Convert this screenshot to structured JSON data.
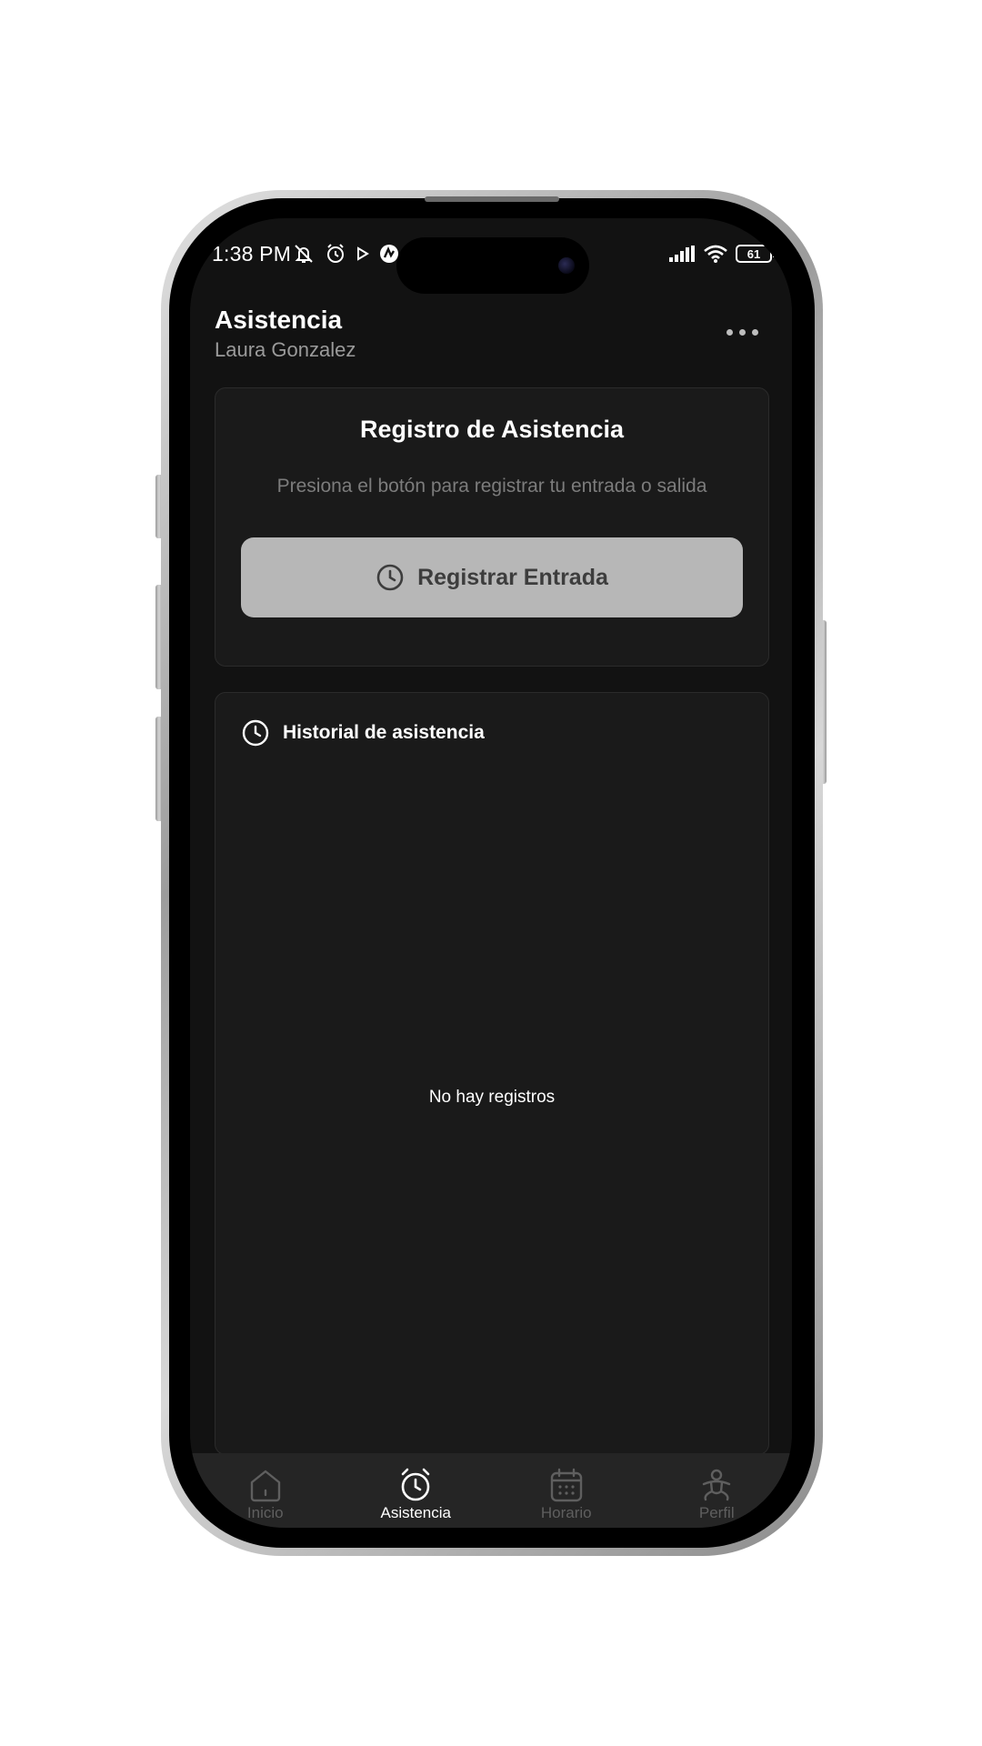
{
  "status_bar": {
    "time": "1:38 PM",
    "battery": "61",
    "left_icons": [
      "bell-off-icon",
      "alarm-icon",
      "play-icon",
      "app-icon"
    ],
    "right_icons": [
      "signal-icon",
      "wifi-icon",
      "battery-icon"
    ]
  },
  "header": {
    "title": "Asistencia",
    "subtitle": "Laura Gonzalez",
    "more_icon": "more-horizontal-icon"
  },
  "register_card": {
    "title": "Registro de Asistencia",
    "description": "Presiona el botón para registrar tu entrada o salida",
    "button_label": "Registrar Entrada",
    "button_icon": "clock-icon"
  },
  "history_card": {
    "title": "Historial de asistencia",
    "icon": "clock-icon",
    "empty_text": "No hay registros"
  },
  "bottom_nav": {
    "items": [
      {
        "label": "Inicio",
        "icon": "home-icon",
        "active": false
      },
      {
        "label": "Asistencia",
        "icon": "alarm-clock-icon",
        "active": true
      },
      {
        "label": "Horario",
        "icon": "calendar-icon",
        "active": false
      },
      {
        "label": "Perfil",
        "icon": "person-icon",
        "active": false
      }
    ]
  },
  "colors": {
    "background": "#121212",
    "card": "#1a1a1a",
    "button": "#b7b7b7",
    "active_nav": "#ffffff",
    "inactive_nav": "#5f5f5f"
  }
}
